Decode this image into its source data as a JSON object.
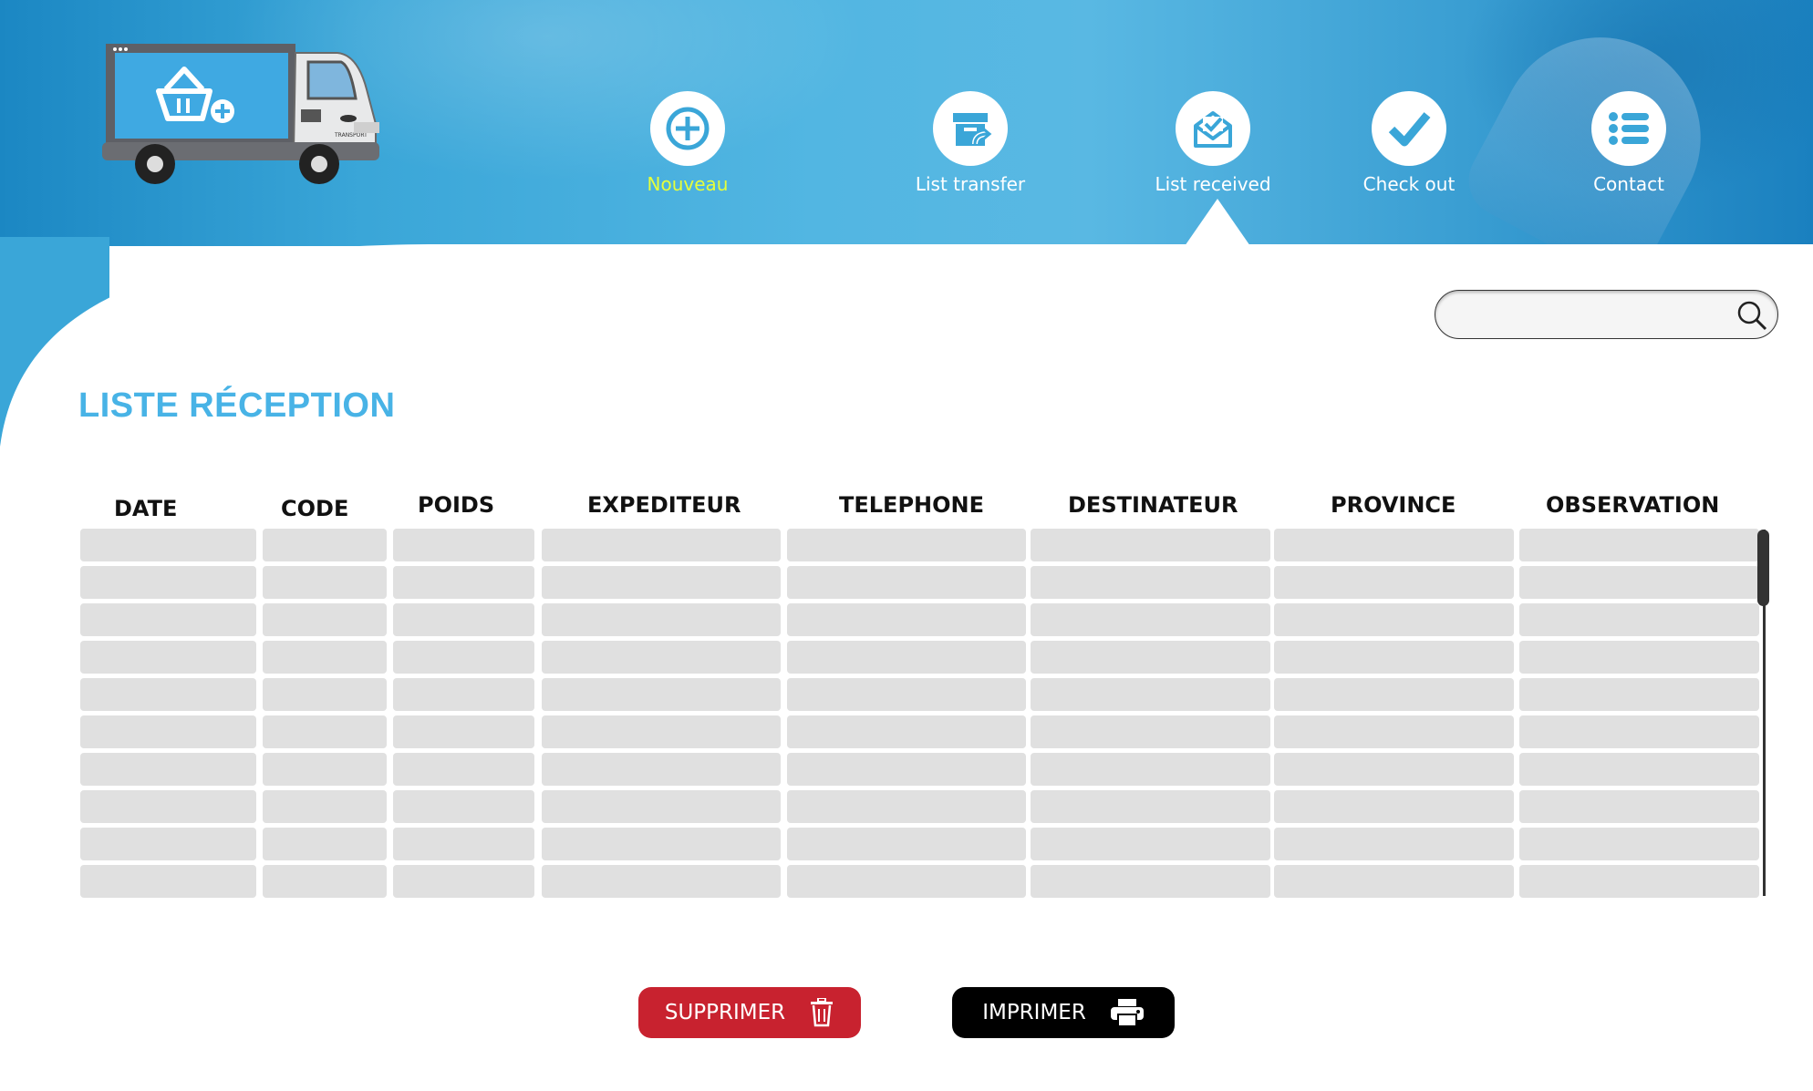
{
  "colors": {
    "header_blue": "#3aa6d8",
    "title_blue": "#48b3e6",
    "active_nav": "#e6ff3a",
    "delete_red": "#c8222f",
    "print_black": "#000000",
    "cell_gray": "#e0e0e0"
  },
  "logo": {
    "truck_text": "TRANSPORT"
  },
  "nav": {
    "items": [
      {
        "label": "Nouveau",
        "icon": "plus-circle-icon",
        "active": true
      },
      {
        "label": "List transfer",
        "icon": "box-transfer-icon",
        "active": false
      },
      {
        "label": "List received",
        "icon": "mail-check-icon",
        "active": false
      },
      {
        "label": "Check out",
        "icon": "checkmark-icon",
        "active": false
      },
      {
        "label": "Contact",
        "icon": "list-icon",
        "active": false
      }
    ],
    "selected": "List received"
  },
  "search": {
    "placeholder": "",
    "value": "",
    "icon": "search-icon"
  },
  "page": {
    "title": "LISTE RÉCEPTION"
  },
  "table": {
    "columns": [
      "DATE",
      "CODE",
      "POIDS",
      "EXPEDITEUR",
      "TELEPHONE",
      "DESTINATEUR",
      "PROVINCE",
      "OBSERVATION"
    ],
    "rows": [
      [
        "",
        "",
        "",
        "",
        "",
        "",
        "",
        ""
      ],
      [
        "",
        "",
        "",
        "",
        "",
        "",
        "",
        ""
      ],
      [
        "",
        "",
        "",
        "",
        "",
        "",
        "",
        ""
      ],
      [
        "",
        "",
        "",
        "",
        "",
        "",
        "",
        ""
      ],
      [
        "",
        "",
        "",
        "",
        "",
        "",
        "",
        ""
      ],
      [
        "",
        "",
        "",
        "",
        "",
        "",
        "",
        ""
      ],
      [
        "",
        "",
        "",
        "",
        "",
        "",
        "",
        ""
      ],
      [
        "",
        "",
        "",
        "",
        "",
        "",
        "",
        ""
      ],
      [
        "",
        "",
        "",
        "",
        "",
        "",
        "",
        ""
      ],
      [
        "",
        "",
        "",
        "",
        "",
        "",
        "",
        ""
      ]
    ]
  },
  "actions": {
    "delete_label": "SUPPRIMER",
    "delete_icon": "trash-icon",
    "print_label": "IMPRIMER",
    "print_icon": "printer-icon"
  }
}
